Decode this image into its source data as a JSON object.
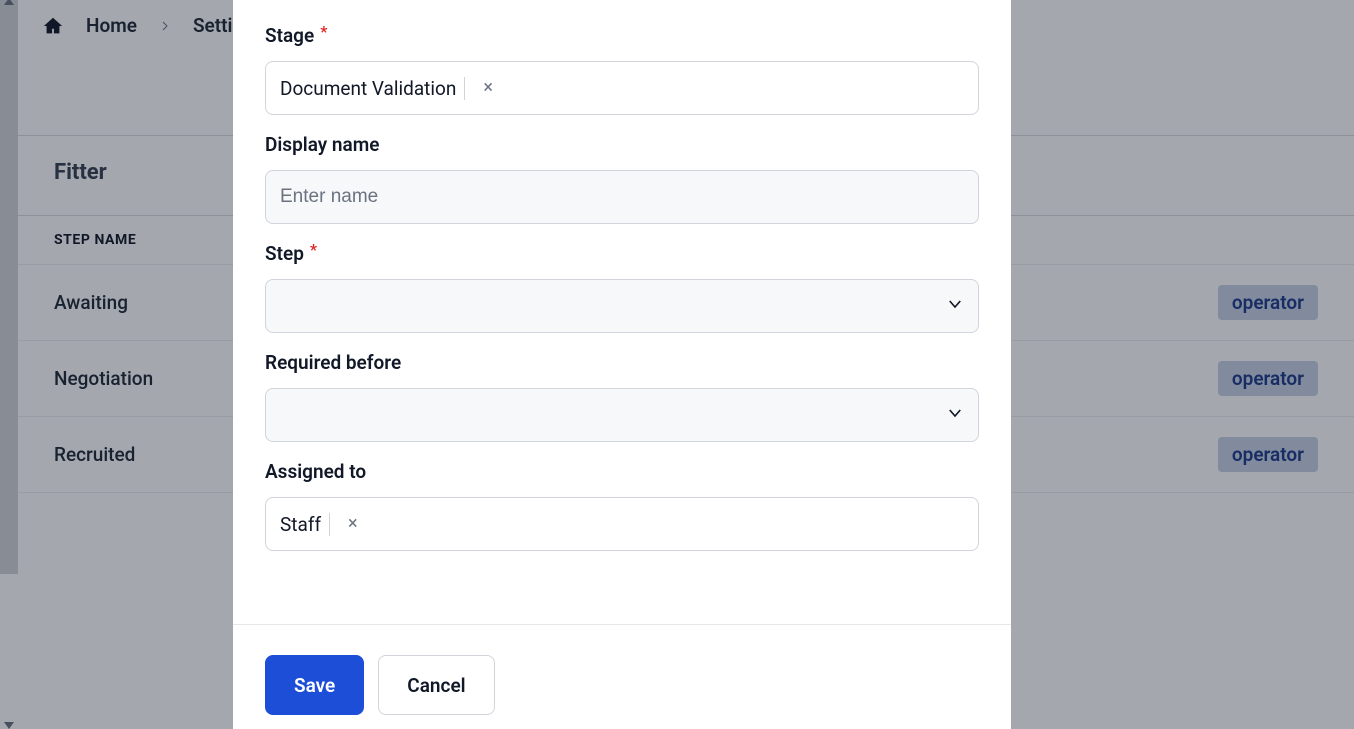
{
  "breadcrumb": {
    "home_label": "Home",
    "settings_label": "Settings"
  },
  "page": {
    "title": "Fitter",
    "column_header": "STEP NAME",
    "rows": [
      {
        "name": "Awaiting",
        "badge": "operator"
      },
      {
        "name": "Negotiation",
        "badge": "operator"
      },
      {
        "name": "Recruited",
        "badge": "operator"
      }
    ]
  },
  "modal": {
    "fields": {
      "stage": {
        "label": "Stage",
        "required": true,
        "chips": [
          "Document Validation"
        ]
      },
      "display_name": {
        "label": "Display name",
        "required": false,
        "placeholder": "Enter name",
        "value": ""
      },
      "step": {
        "label": "Step",
        "required": true,
        "value": ""
      },
      "required_before": {
        "label": "Required before",
        "required": false,
        "value": ""
      },
      "assigned_to": {
        "label": "Assigned to",
        "required": false,
        "chips": [
          "Staff"
        ]
      }
    },
    "buttons": {
      "save": "Save",
      "cancel": "Cancel"
    }
  }
}
